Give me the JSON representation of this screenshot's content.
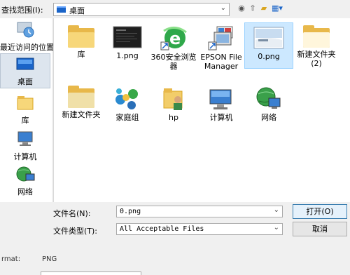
{
  "topbar": {
    "search_label": "查找范围(I):",
    "location_value": "桌面",
    "dropdown_glyph": "⌄",
    "nav_icons": [
      "back-icon",
      "up-folder-icon",
      "new-folder-icon",
      "view-menu-icon"
    ]
  },
  "sidebar": {
    "items": [
      {
        "label": "最近访问的位置",
        "icon": "recent-places-icon"
      },
      {
        "label": "桌面",
        "icon": "desktop-icon"
      },
      {
        "label": "库",
        "icon": "libraries-icon"
      },
      {
        "label": "计算机",
        "icon": "computer-icon"
      },
      {
        "label": "网络",
        "icon": "network-icon"
      }
    ]
  },
  "files": [
    {
      "name": "库",
      "icon": "folder-icon"
    },
    {
      "name": "1.png",
      "icon": "image-icon"
    },
    {
      "name": "360安全浏览器",
      "icon": "browser-shortcut-icon"
    },
    {
      "name": "EPSON File Manager",
      "icon": "epson-shortcut-icon"
    },
    {
      "name": "0.png",
      "icon": "image-icon",
      "selected": true
    },
    {
      "name": "新建文件夹 (2)",
      "icon": "folder-icon"
    },
    {
      "name": "新建文件夹",
      "icon": "folder-icon"
    },
    {
      "name": "家庭组",
      "icon": "homegroup-icon"
    },
    {
      "name": "hp",
      "icon": "user-folder-icon"
    },
    {
      "name": "计算机",
      "icon": "computer-icon"
    },
    {
      "name": "网络",
      "icon": "network-icon"
    }
  ],
  "bottom": {
    "filename_label": "文件名(N):",
    "filename_value": "0.png",
    "filetype_label": "文件类型(T):",
    "filetype_value": "All Acceptable Files",
    "open_button": "打开(O)",
    "cancel_button": "取消",
    "format_label": "rmat:",
    "format_value": "PNG"
  },
  "colors": {
    "selection_bg": "#cce8ff",
    "sidebar_active": "#dde5ee",
    "folder_yellow": "#f7d77a"
  }
}
